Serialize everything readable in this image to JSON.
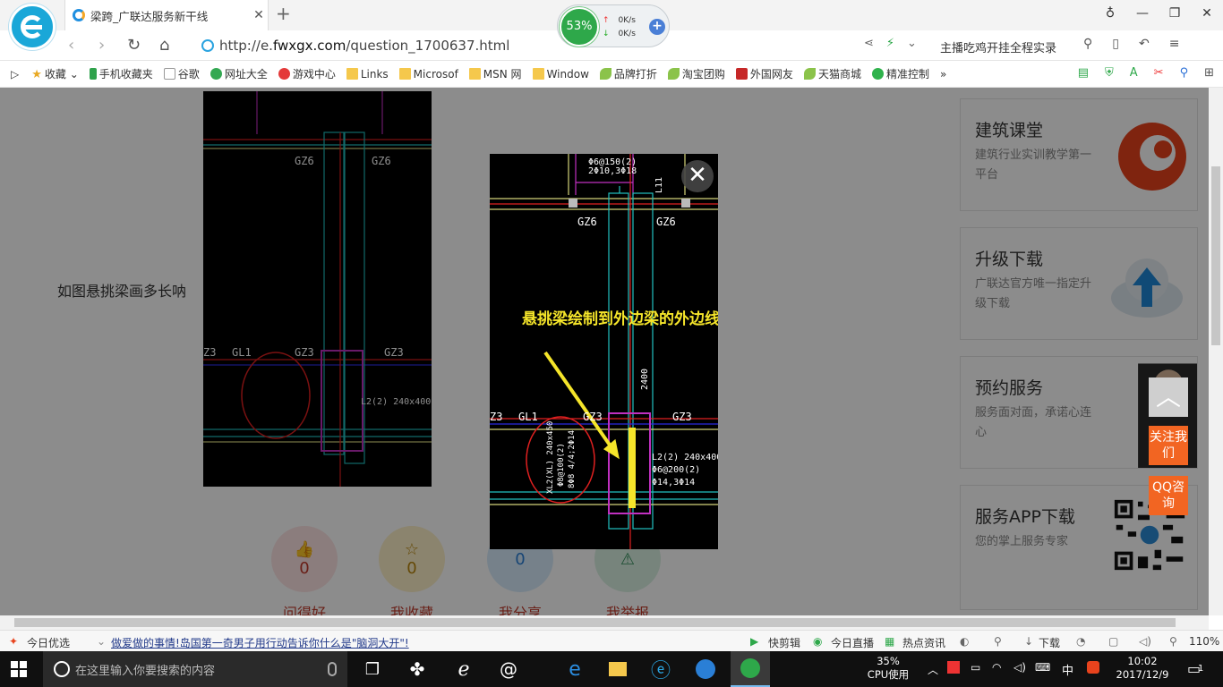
{
  "browser": {
    "tab_title": "梁跨_广联达服务新干线",
    "url_host": "http://e.",
    "url_domain": "fwxgx.com",
    "url_path": "/question_1700637.html",
    "search_hint": "主播吃鸡开挂全程实录",
    "speed_percent": "53%",
    "speed_up": "0K/s",
    "speed_down": "0K/s"
  },
  "bookmarks": [
    {
      "label": "收藏",
      "icon": "star-icon"
    },
    {
      "label": "手机收藏夹",
      "icon": "phone-icon"
    },
    {
      "label": "谷歌",
      "icon": "doc-icon"
    },
    {
      "label": "网址大全",
      "icon": "site-icon"
    },
    {
      "label": "游戏中心",
      "icon": "game-icon"
    },
    {
      "label": "Links",
      "icon": "folder-icon"
    },
    {
      "label": "Microsof",
      "icon": "folder-icon"
    },
    {
      "label": "MSN 网",
      "icon": "folder-icon"
    },
    {
      "label": "Window",
      "icon": "folder-icon"
    },
    {
      "label": "品牌打折",
      "icon": "leaf-icon"
    },
    {
      "label": "淘宝团购",
      "icon": "leaf-icon"
    },
    {
      "label": "外国网友",
      "icon": "flag-icon"
    },
    {
      "label": "天猫商城",
      "icon": "leaf-icon"
    },
    {
      "label": "精准控制",
      "icon": "wechat-icon"
    }
  ],
  "page": {
    "question": "如图悬挑梁画多长呐",
    "annotation": "悬挑梁绘制到外边梁的外边线平齐",
    "actions": [
      {
        "label": "问得好",
        "count": "0"
      },
      {
        "label": "我收藏",
        "count": "0"
      },
      {
        "label": "我分享",
        "count": "0"
      },
      {
        "label": "我举报",
        "count": ""
      }
    ],
    "sidebar": [
      {
        "title": "建筑课堂",
        "desc": "建筑行业实训教学第一平台"
      },
      {
        "title": "升级下载",
        "desc": "广联达官方唯一指定升级下载"
      },
      {
        "title": "预约服务",
        "desc": "服务面对面，承诺心连心"
      },
      {
        "title": "服务APP下载",
        "desc": "您的掌上服务专家"
      }
    ],
    "float_follow": "关注我们",
    "float_qq": "QQ咨询"
  },
  "cad": {
    "labels": {
      "gz6a": "GZ6",
      "gz6b": "GZ6",
      "gl1": "GL1",
      "gz3a": "GZ3",
      "gz3b": "GZ3",
      "z3": "Z3",
      "dim": "2400",
      "top1": "Φ6@150(2)",
      "top2": "2Φ10,3Φ18",
      "l11": "L11",
      "xl_text": "XL2(XL) 240x450",
      "xl_text2": "Φ8@100(2)",
      "xl_text3": "8Φ8 4/4;2Φ14",
      "l2_text": "L2(2) 240x400",
      "l2_text2": "Φ6@200(2)",
      "l2_text3": "Φ14,3Φ14"
    }
  },
  "statusbar": {
    "today": "今日优选",
    "news": "做爱做的事情!岛国第一奇男子用行动告诉你什么是\"脑洞大开\"!",
    "items": [
      "快剪辑",
      "今日直播",
      "热点资讯"
    ],
    "download": "下载",
    "zoom": "110%"
  },
  "taskbar": {
    "search_placeholder": "在这里输入你要搜索的内容",
    "cpu_percent": "35%",
    "cpu_label": "CPU使用",
    "ime": "中",
    "time": "10:02",
    "date": "2017/12/9",
    "notify_count": "1"
  },
  "colors": {
    "accent_orange": "#f26522",
    "annotation_yellow": "#f5e52a",
    "tab_blue": "#1aa7d8"
  }
}
